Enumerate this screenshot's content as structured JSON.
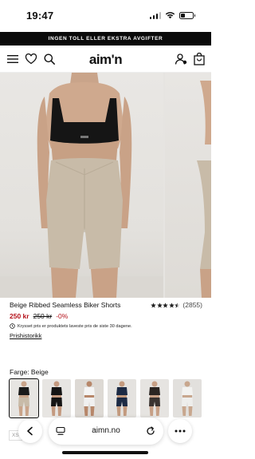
{
  "status": {
    "time": "19:47",
    "battery_level": 0.35
  },
  "promo": {
    "text": "INGEN TOLL ELLER EKSTRA AVGIFTER"
  },
  "header": {
    "logo": "aim'n"
  },
  "product": {
    "title": "Beige Ribbed Seamless Biker Shorts",
    "rating_stars": 4.5,
    "review_count": "(2855)",
    "price_now": "250 kr",
    "price_old": "250 kr",
    "discount": "-0%",
    "price_note": "Krysset pris er produktets laveste pris de siste 30 dagene.",
    "history_link": "Prishistorikk",
    "color_label": "Farge: Beige",
    "size_first": "XS"
  },
  "swatches": [
    {
      "name": "Beige",
      "top": "#1a1a1a",
      "bottom": "#c8bba8",
      "skin": "#c9a48a",
      "bg": "#e7e5e2",
      "selected": true
    },
    {
      "name": "Black",
      "top": "#151515",
      "bottom": "#151515",
      "skin": "#c49a80",
      "bg": "#e7e5e2",
      "selected": false
    },
    {
      "name": "White",
      "top": "#f4f4f4",
      "bottom": "#f0f0f0",
      "skin": "#b7876a",
      "bg": "#ddd9d4",
      "selected": false
    },
    {
      "name": "Navy",
      "top": "#1c2a44",
      "bottom": "#1c2a44",
      "skin": "#c39a7e",
      "bg": "#e4e2df",
      "selected": false
    },
    {
      "name": "Dark Brown",
      "top": "#2b2522",
      "bottom": "#3a3330",
      "skin": "#c7a086",
      "bg": "#e6e4e1",
      "selected": false
    },
    {
      "name": "Ivory",
      "top": "#f2f2f0",
      "bottom": "#eeeeec",
      "skin": "#c8a78e",
      "bg": "#e2e0dd",
      "selected": false
    }
  ],
  "browser": {
    "url": "aimn.no"
  },
  "colors": {
    "sale": "#b5121b",
    "banner": "#0a0a0a"
  }
}
